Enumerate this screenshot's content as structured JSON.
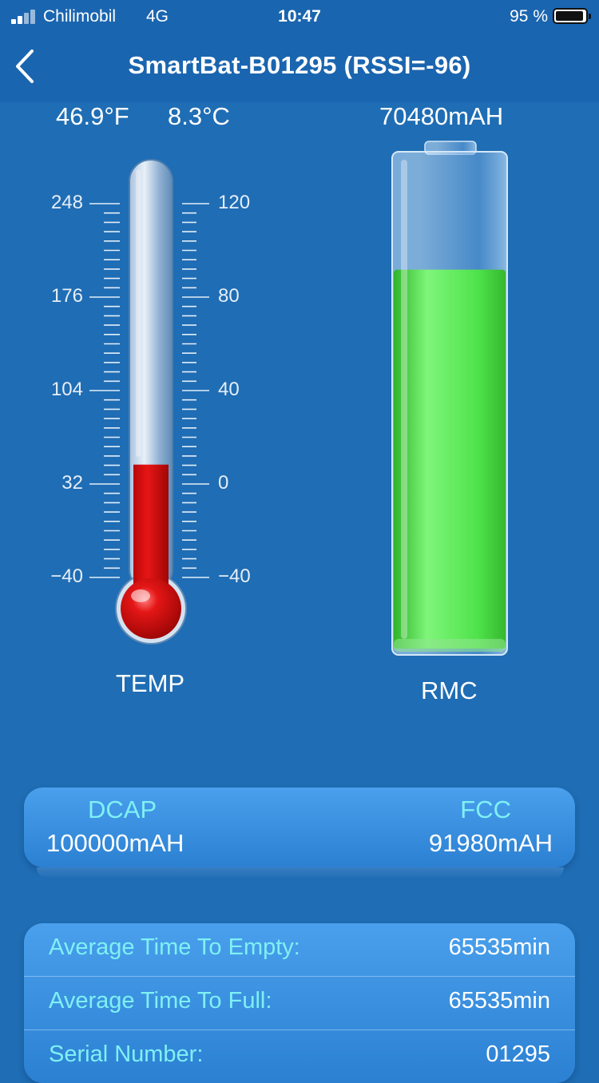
{
  "status_bar": {
    "carrier": "Chilimobil",
    "network": "4G",
    "time": "10:47",
    "battery_percent": "95 %"
  },
  "nav": {
    "title": "SmartBat-B01295 (RSSI=-96)",
    "back_icon": "chevron-left-icon"
  },
  "readouts": {
    "temp_f": "46.9°F",
    "temp_c": "8.3°C",
    "rmc": "70480mAH"
  },
  "thermometer": {
    "caption": "TEMP",
    "fahrenheit_ticks": [
      "248",
      "176",
      "104",
      "32",
      "−40"
    ],
    "celsius_ticks": [
      "120",
      "80",
      "40",
      "0",
      "−40"
    ],
    "celsius_min": -40,
    "celsius_max": 120,
    "current_celsius": 8.3,
    "fluid_color": "#d91010"
  },
  "battery_gauge": {
    "caption": "RMC",
    "fill_fraction": 0.77,
    "fill_color": "#4ee34a"
  },
  "capacity_card": {
    "dcap_label": "DCAP",
    "dcap_value": "100000mAH",
    "fcc_label": "FCC",
    "fcc_value": "91980mAH"
  },
  "info_rows": [
    {
      "label": "Average Time To Empty:",
      "value": "65535min"
    },
    {
      "label": "Average Time To Full:",
      "value": "65535min"
    },
    {
      "label": "Serial Number:",
      "value": "01295"
    }
  ],
  "colors": {
    "background": "#1f6db4",
    "nav_bar": "#1a65af",
    "label_accent": "#7ff0f4"
  }
}
